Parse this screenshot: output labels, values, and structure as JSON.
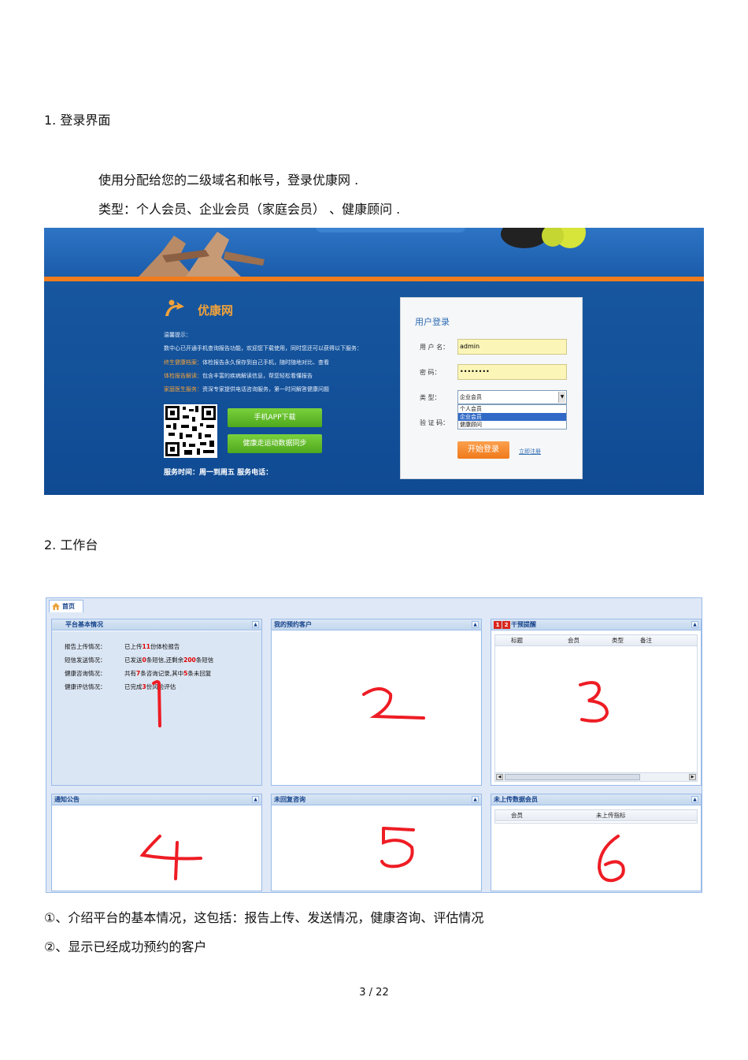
{
  "section1": {
    "heading": "1.   登录界面",
    "desc_line1": "使用分配给您的二级域名和帐号，登录优康网      .",
    "desc_line2": "类型：个人会员、企业会员（家庭会员）   、健康顾问 ."
  },
  "login_screen": {
    "logo_text": "优康网",
    "tips_title": "温馨提示：",
    "tips": [
      {
        "hl": "",
        "text": "数中心已开通手机查询报告功能，欢迎您下载使用，同时您还可以获得以下服务："
      },
      {
        "hl": "终生健康档案：",
        "text": "体检报告永久保存到自己手机，随时随地对比、查看"
      },
      {
        "hl": "体检报告解读：",
        "text": "包含丰富的疾病解读信息，帮您轻松看懂报告"
      },
      {
        "hl": "家庭医生服务：",
        "text": "资深专家提供电话咨询服务，第一时间解答健康问题"
      }
    ],
    "app_download_button": "手机APP下载",
    "sync_button": "健康走运动数据同步",
    "service_line": "服务时间：周一到周五 服务电话：",
    "box": {
      "title": "用户登录",
      "username_label": "用 户 名：",
      "username_value": "admin",
      "password_label": "密     码：",
      "password_value": "••••••••",
      "type_label": "类     型：",
      "type_selected": "企业会员",
      "type_options": [
        "个人会员",
        "企业会员",
        "健康顾问"
      ],
      "type_highlighted_index": 1,
      "captcha_label": "验 证 码：",
      "login_button": "开始登录",
      "register_link": "立即注册"
    }
  },
  "section2": {
    "heading": "2.   工作台"
  },
  "workbench": {
    "tab": "首页",
    "panels": {
      "p1": {
        "title": "平台基本情况",
        "rows": [
          {
            "label": "报告上传情况：",
            "pre": "已上传",
            "n1": "11",
            "mid": "份体检报告",
            "n2": "",
            "post": ""
          },
          {
            "label": "短信发送情况：",
            "pre": "已发送",
            "n1": "0",
            "mid": "条短信,还剩余",
            "n2": "200",
            "post": "条短信"
          },
          {
            "label": "健康咨询情况：",
            "pre": "共有",
            "n1": "7",
            "mid": "条咨询记录,其中",
            "n2": "5",
            "post": "条未回复"
          },
          {
            "label": "健康评估情况：",
            "pre": "已完成",
            "n1": "3",
            "mid": "份风险评估",
            "n2": "",
            "post": ""
          }
        ],
        "marker": "1"
      },
      "p2": {
        "title": "我的预约客户",
        "marker": "2"
      },
      "p3": {
        "title": "干预提醒",
        "flags": [
          "1",
          "2"
        ],
        "columns": [
          "标题",
          "会员",
          "类型",
          "备注"
        ],
        "marker": "3"
      },
      "p4": {
        "title": "通知公告",
        "marker": "4"
      },
      "p5": {
        "title": "未回复咨询",
        "marker": "5"
      },
      "p6": {
        "title": "未上传数据会员",
        "columns": [
          "会员",
          "未上传指标"
        ],
        "marker": "6"
      }
    }
  },
  "notes": {
    "line1": "①、介绍平台的基本情况，这包括：报告上传、发送情况，健康咨询、评估情况",
    "line2": "②、显示已经成功预约的客户"
  },
  "page_number": "3 / 22"
}
